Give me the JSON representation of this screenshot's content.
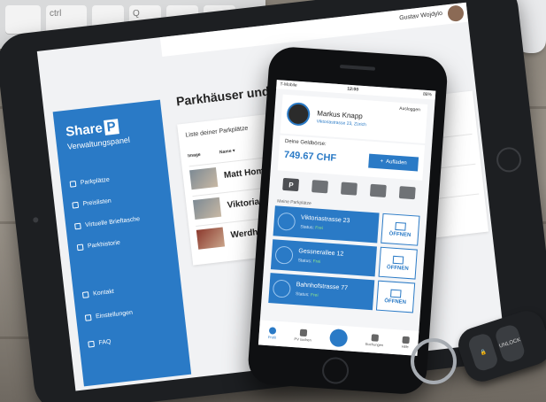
{
  "keyboard": {
    "keys": [
      "ctrl",
      "Q"
    ]
  },
  "key_fob": {
    "button_labels": [
      "UNLOCK"
    ]
  },
  "tablet": {
    "header_user": "Gustav Wojdylo",
    "page_title": "Parkhäuser und Stellplätze",
    "sidebar": {
      "brand": "Share",
      "brand_box": "P",
      "subtitle": "Verwaltungspanel",
      "items": [
        {
          "label": "Parkplätze",
          "icon": "list-icon"
        },
        {
          "label": "Preislisten",
          "icon": "tag-icon"
        },
        {
          "label": "Virtuelle Brieftasche",
          "icon": "wallet-icon"
        },
        {
          "label": "Parkhistorie",
          "icon": "history-icon"
        },
        {
          "label": "Kontakt",
          "icon": "chat-icon"
        },
        {
          "label": "Einstellungen",
          "icon": "sliders-icon"
        },
        {
          "label": "FAQ",
          "icon": "faq-icon"
        }
      ]
    },
    "card": {
      "title": "Liste deiner Parkplätze",
      "columns": [
        "Image",
        "Name ▾"
      ],
      "rows": [
        {
          "name": "Matt Home"
        },
        {
          "name": "Viktoriastrasse 23"
        },
        {
          "name": "Werdhölzlistrasse"
        }
      ]
    }
  },
  "phone": {
    "status": {
      "carrier": "T-Mobile",
      "time": "12:00",
      "battery": "88%"
    },
    "logout_label": "Ausloggen",
    "user_name": "Markus Knapp",
    "user_address": "Viktoriastrasse 23, Zürich",
    "wallet_label": "Deine Geldbörse:",
    "balance": "749.67 CHF",
    "topup_label": "Aufladen",
    "filters": [
      "P",
      "covered-icon",
      "filter-icon",
      "garage-icon",
      "car-icon"
    ],
    "list_title": "Meine Parkplätze",
    "lots": [
      {
        "name": "Viktoriastrasse 23",
        "status_label": "Status:",
        "status": "Frei",
        "action": "ÖFFNEN"
      },
      {
        "name": "Gessnerallee 12",
        "status_label": "Status:",
        "status": "Frei",
        "action": "ÖFFNEN"
      },
      {
        "name": "Bahnhofstrasse 77",
        "status_label": "Status:",
        "status": "Frei",
        "action": "ÖFFNEN"
      }
    ],
    "tabs": [
      {
        "label": "Profil",
        "icon": "user-icon"
      },
      {
        "label": "PV suchen",
        "icon": "search-icon"
      },
      {
        "label": "",
        "icon": "scan-icon"
      },
      {
        "label": "Buchungen",
        "icon": "bookings-icon"
      },
      {
        "label": "Hilfe",
        "icon": "help-icon"
      }
    ],
    "accent_color": "#2a7ac6"
  }
}
